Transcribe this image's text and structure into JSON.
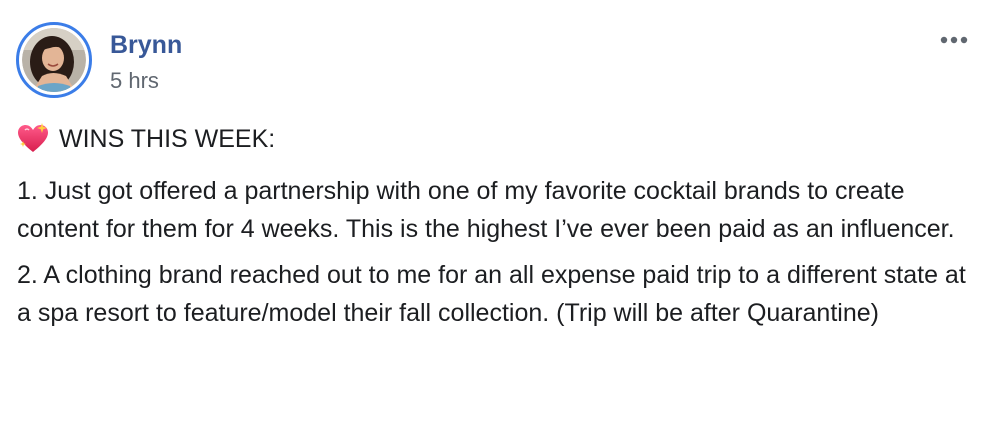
{
  "post": {
    "author": "Brynn",
    "timestamp": "5 hrs",
    "heading": "WINS THIS WEEK:",
    "paragraphs": [
      "1. Just got offered a partnership with one of my favorite cocktail brands to create content for them for 4 weeks. This is the highest I’ve ever been paid as an influencer.",
      "2. A clothing brand reached out to me for an all expense paid trip to a different state at a spa resort to feature/model their fall collection. (Trip will be after Quarantine)"
    ]
  },
  "icons": {
    "heading_emoji": "sparkling-heart-icon",
    "more": "more-options-icon"
  },
  "colors": {
    "author": "#385898",
    "timestamp": "#606770",
    "avatar_ring": "#3b7de8",
    "heart": "#e0245e"
  }
}
